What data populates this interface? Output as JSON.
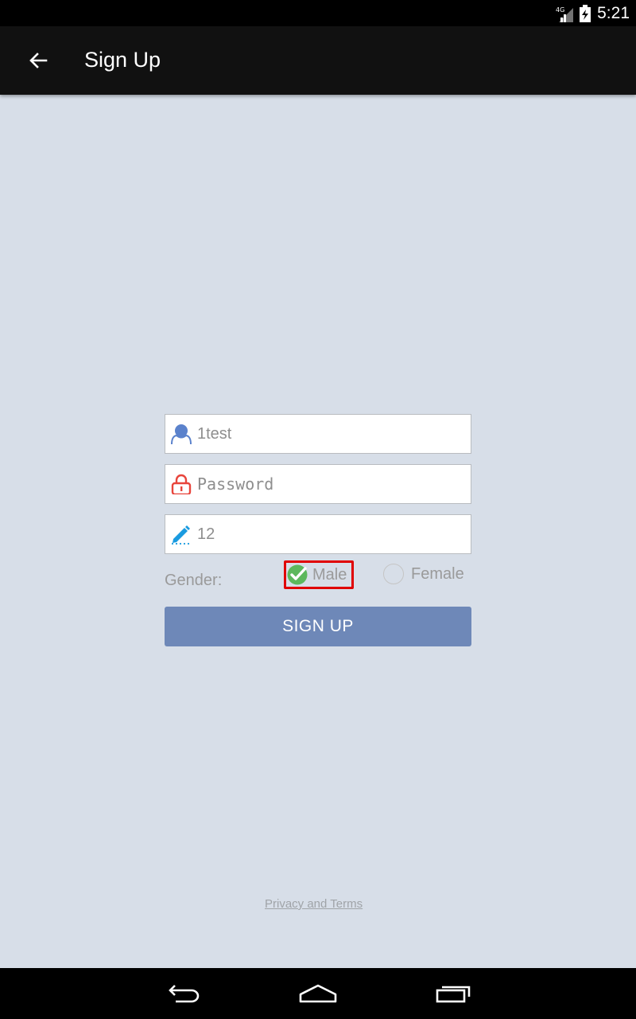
{
  "status": {
    "network": "4G",
    "time": "5:21"
  },
  "app_bar": {
    "title": "Sign Up"
  },
  "form": {
    "username_value": "1test",
    "password_placeholder": "Password",
    "code_value": "12",
    "gender_label": "Gender:",
    "gender_options": [
      {
        "label": "Male",
        "selected": true
      },
      {
        "label": "Female",
        "selected": false
      }
    ],
    "submit_label": "SIGN UP"
  },
  "footer": {
    "privacy_link": "Privacy and Terms"
  },
  "colors": {
    "background": "#d7dee8",
    "app_bar": "#111111",
    "button": "#6e88b8",
    "user_icon": "#5b82cc",
    "lock_icon": "#e8453c",
    "pencil_icon": "#1a9be0",
    "check": "#5cb85c",
    "highlight": "#e00000"
  }
}
